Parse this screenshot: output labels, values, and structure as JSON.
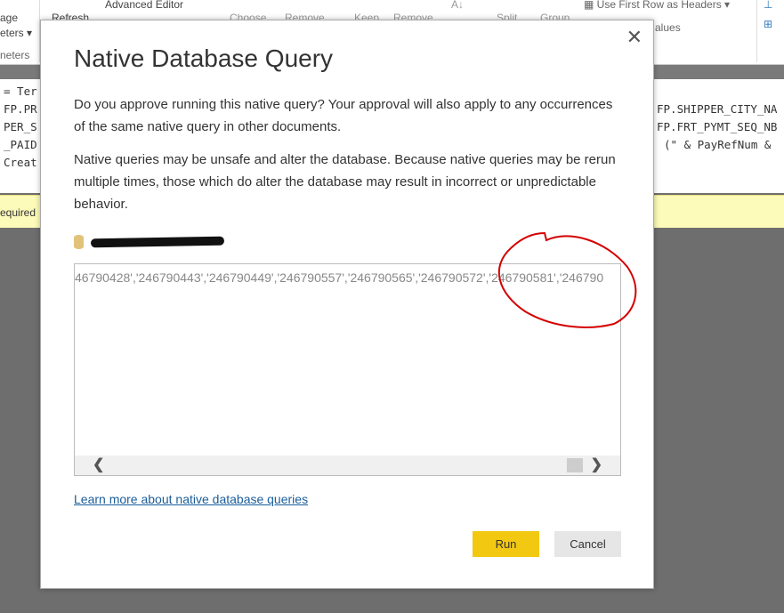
{
  "ribbon": {
    "manage_params_1": "age",
    "manage_params_2": "eters ▾",
    "group_params": "neters",
    "refresh": "Refresh",
    "advanced_editor": "Advanced Editor",
    "choose": "Choose",
    "remove": "Remove",
    "keep": "Keep",
    "remove2": "Remove",
    "split": "Split",
    "group": "Group",
    "use_first_row": "Use First Row as Headers ▾",
    "values": "alues"
  },
  "code_left": [
    "= Ter",
    "FP.PR",
    "PER_S",
    "_PAID",
    "Creat"
  ],
  "code_right": [
    "FP.SHIPPER_CITY_NA",
    "FP.FRT_PYMT_SEQ_NB",
    "(\" & PayRefNum &"
  ],
  "warning": "equired",
  "dialog": {
    "title": "Native Database Query",
    "para1": "Do you approve running this native query? Your approval will also apply to any occurrences of the same native query in other documents.",
    "para2": "Native queries may be unsafe and alter the database. Because native queries may be rerun multiple times, those which do alter the database may result in incorrect or unpredictable behavior.",
    "query_text": "46790428','246790443','246790449','246790557','246790565','246790572','246790581','246790",
    "learn_more": "Learn more about native database queries",
    "run": "Run",
    "cancel": "Cancel",
    "close_icon": "close-icon",
    "run_color": "#f2c811",
    "annotation_color": "#d40000"
  }
}
